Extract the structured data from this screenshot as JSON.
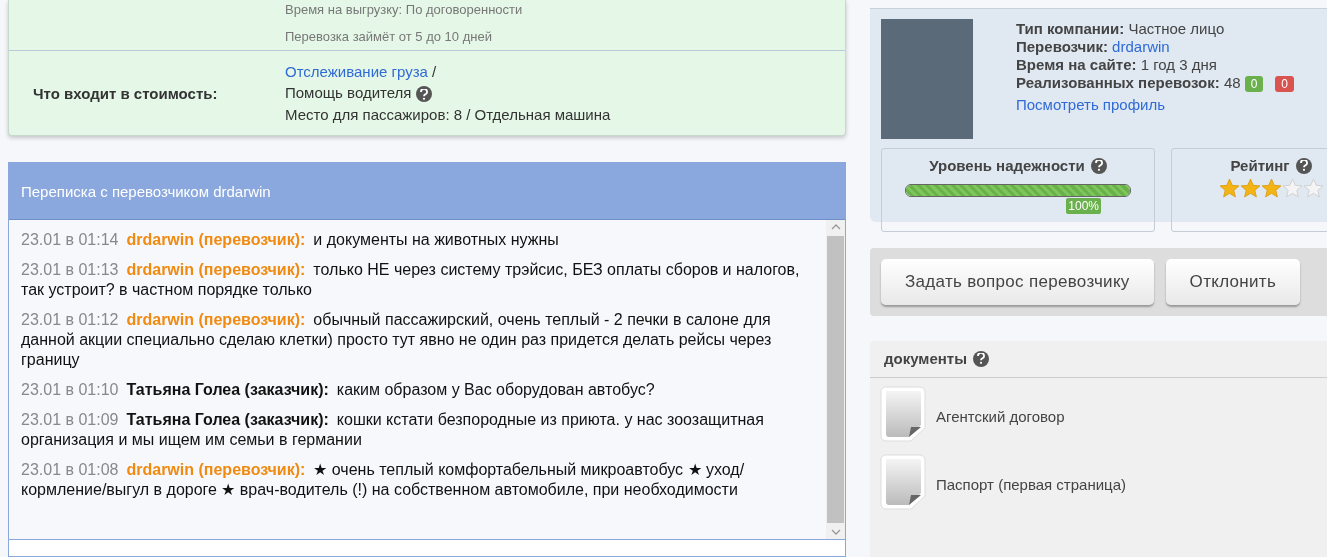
{
  "shipment": {
    "time_rows": [
      "Время на выгрузку: По договоренности",
      "Перевозка займёт от 5 до 10 дней"
    ],
    "included_label": "Что входит в стоимость:",
    "included": [
      {
        "kind": "link",
        "text": "Отслеживание груза",
        "after": "/"
      },
      {
        "kind": "help",
        "text": "Помощь водителя"
      },
      {
        "kind": "text",
        "text": "Место для пассажиров: 8 / Отдельная машина"
      }
    ]
  },
  "chat": {
    "title": "Переписка с перевозчиком drdarwin",
    "messages": [
      {
        "time": "23.01 в 01:14",
        "author": "drdarwin (перевозчик):",
        "kind": "carrier",
        "text": "и документы на животных нужны"
      },
      {
        "time": "23.01 в 01:13",
        "author": "drdarwin (перевозчик):",
        "kind": "carrier",
        "text": "только НЕ через систему трэйсис, БЕЗ оплаты сборов и налогов, так устроит? в частном порядке только"
      },
      {
        "time": "23.01 в 01:12",
        "author": "drdarwin (перевозчик):",
        "kind": "carrier",
        "text": "обычный пассажирский, очень теплый - 2 печки в салоне для данной акции специально сделаю клетки) просто тут явно не один раз придется делать рейсы через границу"
      },
      {
        "time": "23.01 в 01:10",
        "author": "Татьяна Голеа (заказчик):",
        "kind": "customer",
        "text": "каким образом у Вас оборудован автобус?"
      },
      {
        "time": "23.01 в 01:09",
        "author": "Татьяна Голеа (заказчик):",
        "kind": "customer",
        "text": "кошки кстати безпородные из приюта. у нас зоозащитная организация и мы ищем им семьи в германии"
      },
      {
        "time": "23.01 в 01:08",
        "author": "drdarwin (перевозчик):",
        "kind": "carrier",
        "text": "★ очень теплый комфортабельный микроавтобус ★ уход/кормление/выгул в дороге ★ врач-водитель (!) на собственном автомобиле, при необходимости"
      }
    ]
  },
  "profile": {
    "fields": [
      {
        "label": "Тип компании:",
        "value": "Частное лицо",
        "kind": "text"
      },
      {
        "label": "Перевозчик:",
        "value": "drdarwin",
        "kind": "link"
      },
      {
        "label": "Время на сайте:",
        "value": "1 год 3 дня",
        "kind": "text"
      },
      {
        "label": "Реализованных перевозок:",
        "value": "48",
        "kind": "count",
        "positive": "0",
        "negative": "0"
      }
    ],
    "profile_link": "Посмотреть профиль",
    "reliability": {
      "title": "Уровень надежности",
      "level": 1,
      "reading": "100%"
    },
    "rating": {
      "title": "Рейтинг",
      "stars": 3
    }
  },
  "buttons": [
    "Задать вопрос перевозчику",
    "Отклонить"
  ],
  "documents": {
    "title": "документы",
    "items": [
      "Агентский договор",
      "Паспорт (первая страница)"
    ]
  }
}
